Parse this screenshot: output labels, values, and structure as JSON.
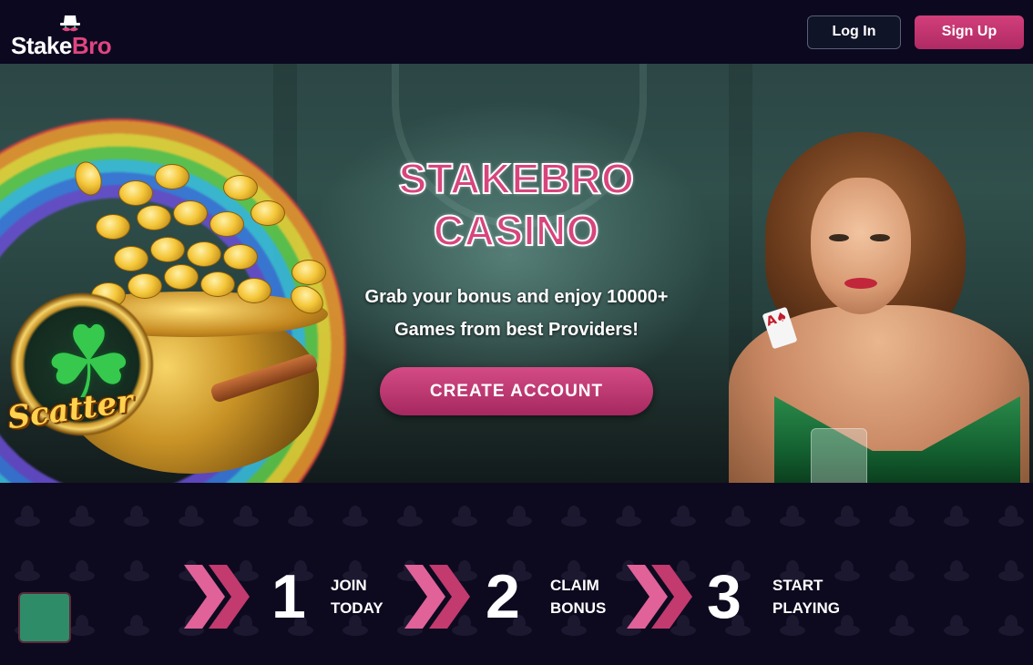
{
  "header": {
    "logo_part1": "Stake",
    "logo_part2": "Bro",
    "login_label": "Log In",
    "signup_label": "Sign Up"
  },
  "hero": {
    "title_line1": "STAKEBRO",
    "title_line2": "CASINO",
    "subtitle_line1": "Grab your bonus and enjoy 10000+",
    "subtitle_line2": "Games from best Providers!",
    "cta_label": "CREATE ACCOUNT",
    "scatter_text": "Scatter",
    "card_text": "A♠"
  },
  "steps": [
    {
      "number": "1",
      "line1": "JOIN",
      "line2": "TODAY"
    },
    {
      "number": "2",
      "line1": "CLAIM",
      "line2": "BONUS"
    },
    {
      "number": "3",
      "line1": "START",
      "line2": "PLAYING"
    }
  ],
  "colors": {
    "brand_pink": "#d8457d",
    "background": "#0d0a1f",
    "chevron_light": "#e06298",
    "chevron_dark": "#c23a6e",
    "chat_green": "#2f8c68"
  },
  "icons": {
    "logo": "hat-mustache-icon",
    "steps": "double-chevron-right-icon",
    "chat": "chat-widget-icon"
  }
}
